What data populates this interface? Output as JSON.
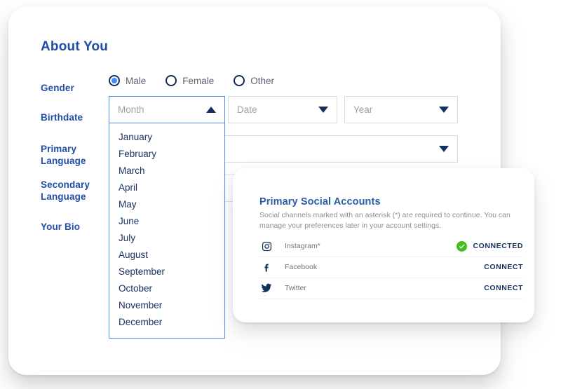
{
  "form": {
    "heading": "About You",
    "labels": {
      "gender": "Gender",
      "birthdate": "Birthdate",
      "primary_language": "Primary\nLanguage",
      "primary_language_line1": "Primary",
      "primary_language_line2": "Language",
      "secondary_language_line1": "Secondary",
      "secondary_language_line2": "Language",
      "your_bio": "Your Bio"
    },
    "gender_options": [
      {
        "label": "Male",
        "selected": true
      },
      {
        "label": "Female",
        "selected": false
      },
      {
        "label": "Other",
        "selected": false
      }
    ],
    "selects": {
      "month": {
        "placeholder": "Month",
        "value": "",
        "expanded": true,
        "caret": "caret-up-icon"
      },
      "date": {
        "placeholder": "Date",
        "value": "",
        "expanded": false,
        "caret": "caret-down-icon"
      },
      "year": {
        "placeholder": "Year",
        "value": "",
        "expanded": false,
        "caret": "caret-down-icon"
      },
      "primary_language": {
        "placeholder": "",
        "value": "",
        "expanded": false,
        "caret": "caret-down-icon"
      },
      "secondary_language": {
        "placeholder": "",
        "value": "",
        "expanded": false,
        "caret": "caret-down-icon"
      }
    },
    "month_options": [
      "January",
      "February",
      "March",
      "April",
      "May",
      "June",
      "July",
      "August",
      "September",
      "October",
      "November",
      "December"
    ]
  },
  "social": {
    "title": "Primary Social Accounts",
    "description": "Social channels marked with an asterisk (*) are required to continue. You can manage your preferences later in your account settings.",
    "accounts": [
      {
        "icon": "instagram-icon",
        "name": "Instagram*",
        "action": "CONNECTED",
        "connected": true
      },
      {
        "icon": "facebook-icon",
        "name": "Facebook",
        "action": "CONNECT",
        "connected": false
      },
      {
        "icon": "twitter-icon",
        "name": "Twitter",
        "action": "CONNECT",
        "connected": false
      }
    ]
  },
  "colors": {
    "heading": "#1f4fa8",
    "label": "#1f4fa8",
    "navy": "#14315c",
    "accent_blue": "#4a90f0",
    "radio_dot": "#3d8bfd",
    "connected_green": "#44be1e",
    "muted_text": "#8a9099"
  }
}
